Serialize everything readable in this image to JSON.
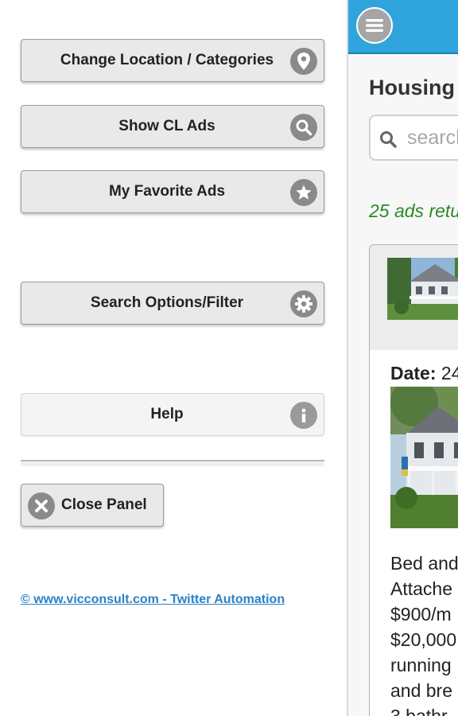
{
  "panel": {
    "buttons": [
      {
        "label": "Change Location / Categories",
        "icon": "map-pin-icon"
      },
      {
        "label": "Show CL Ads",
        "icon": "search-icon"
      },
      {
        "label": "My Favorite Ads",
        "icon": "star-icon"
      },
      {
        "label": "Search Options/Filter",
        "icon": "gear-icon"
      },
      {
        "label": "Help",
        "icon": "info-icon"
      }
    ],
    "close_label": "Close Panel",
    "footer_link": "© www.vicconsult.com - Twitter Automation"
  },
  "main": {
    "title": "Housing",
    "search_placeholder": "search",
    "results_text": "25 ads retu",
    "listing": {
      "date_label": "Date:",
      "date_value": "24",
      "description_lines": [
        "Bed and",
        "Attache",
        "$900/m",
        "$20,000",
        "running",
        "and bre",
        "3 bathr"
      ]
    }
  },
  "colors": {
    "header_blue": "#2fa3db",
    "results_green": "#2a8a2a",
    "link_blue": "#2a82c8",
    "icon_grey": "#8a8a8a"
  }
}
